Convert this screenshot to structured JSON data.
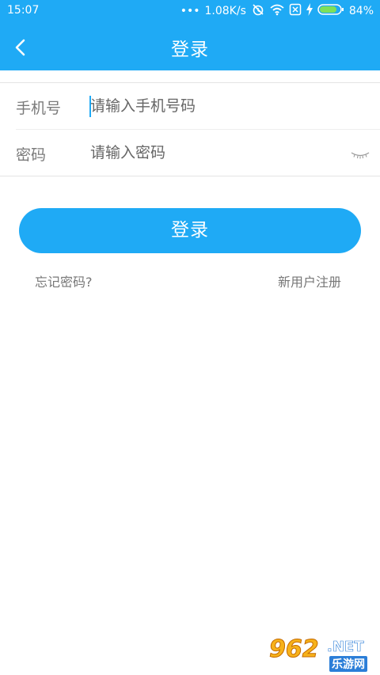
{
  "status_bar": {
    "time": "15:07",
    "dots": "•••",
    "net_speed": "1.08K/s",
    "battery_percent": "84%",
    "icons": [
      "alarm-off-icon",
      "wifi-icon",
      "sim-x-icon",
      "charging-icon",
      "battery-icon"
    ],
    "battery_level": 0.84
  },
  "header": {
    "back_icon": "chevron-left-icon",
    "title": "登录"
  },
  "form": {
    "phone": {
      "label": "手机号",
      "placeholder": "请输入手机号码",
      "value": ""
    },
    "password": {
      "label": "密码",
      "placeholder": "请输入密码",
      "value": "",
      "toggle_icon": "eye-closed-icon"
    }
  },
  "actions": {
    "login_label": "登录",
    "forgot_password": "忘记密码?",
    "register": "新用户注册"
  },
  "watermark": {
    "number": "962",
    "suffix": ".NET",
    "sub": "乐游网"
  },
  "colors": {
    "primary": "#1faaf5",
    "label": "#7a7a7a",
    "link": "#777777"
  }
}
